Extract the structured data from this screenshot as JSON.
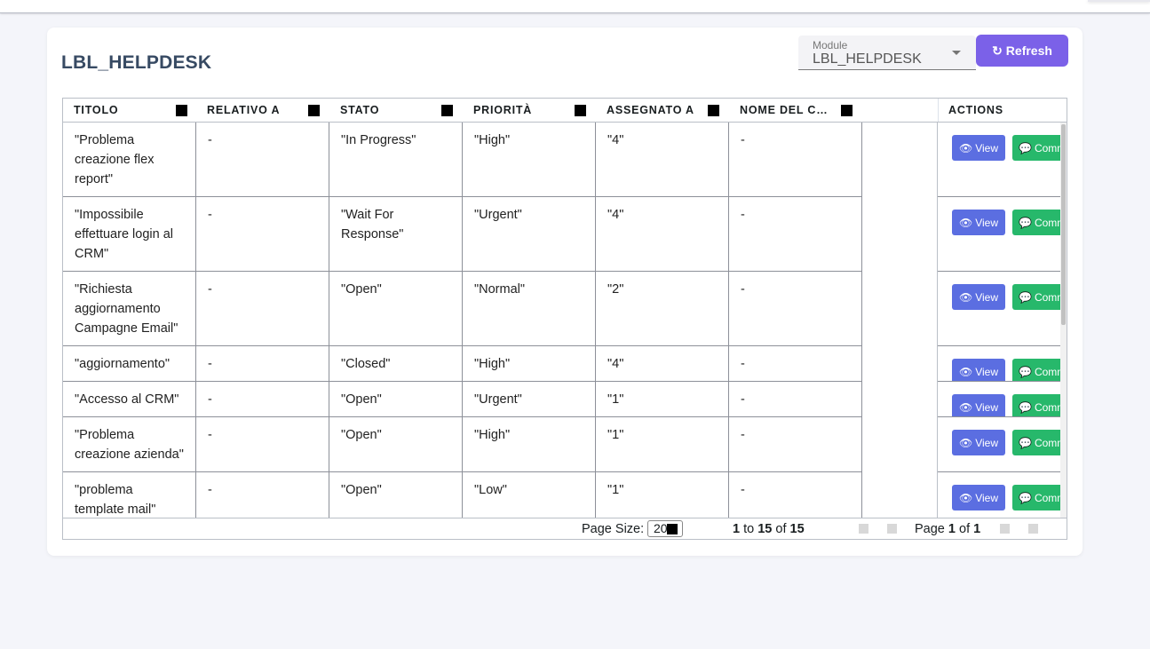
{
  "app": {
    "title": "LBL_HELPDESK"
  },
  "module_select": {
    "caption": "Module",
    "value": "LBL_HELPDESK"
  },
  "toolbar": {
    "refresh_label": "Refresh",
    "refresh_icon": "refresh-icon"
  },
  "grid": {
    "columns": [
      "TITOLO",
      "RELATIVO A",
      "STATO",
      "PRIORITÀ",
      "ASSEGNATO A",
      "NOME DEL CO…"
    ],
    "actions_header": "ACTIONS",
    "rows": [
      {
        "titolo": "\"Problema creazione flex report\"",
        "relativo": "-",
        "stato": "\"In Progress\"",
        "priorita": "\"High\"",
        "assegnato": "\"4\"",
        "nome": "-"
      },
      {
        "titolo": "\"Impossibile effettuare login al CRM\"",
        "relativo": "-",
        "stato": "\"Wait For Response\"",
        "priorita": "\"Urgent\"",
        "assegnato": "\"4\"",
        "nome": "-"
      },
      {
        "titolo": "\"Richiesta aggiornamento Campagne Email\"",
        "relativo": "-",
        "stato": "\"Open\"",
        "priorita": "\"Normal\"",
        "assegnato": "\"2\"",
        "nome": "-"
      },
      {
        "titolo": "\"aggiornamento\"",
        "relativo": "-",
        "stato": "\"Closed\"",
        "priorita": "\"High\"",
        "assegnato": "\"4\"",
        "nome": "-"
      },
      {
        "titolo": "\"Accesso al CRM\"",
        "relativo": "-",
        "stato": "\"Open\"",
        "priorita": "\"Urgent\"",
        "assegnato": "\"1\"",
        "nome": "-"
      },
      {
        "titolo": "\"Problema creazione azienda\"",
        "relativo": "-",
        "stato": "\"Open\"",
        "priorita": "\"High\"",
        "assegnato": "\"1\"",
        "nome": "-"
      },
      {
        "titolo": "\"problema template mail\"",
        "relativo": "-",
        "stato": "\"Open\"",
        "priorita": "\"Low\"",
        "assegnato": "\"1\"",
        "nome": "-"
      }
    ],
    "view_label": "View",
    "comment_label": "Comm",
    "view_icon": "eye-icon",
    "comment_icon": "speech-bubble-icon"
  },
  "paging": {
    "page_size_label": "Page Size:",
    "page_size_value": "20",
    "from": "1",
    "to_word": "to",
    "to": "15",
    "of_word": "of",
    "total": "15",
    "page_word": "Page",
    "page": "1",
    "page_of_word": "of",
    "pages": "1"
  }
}
